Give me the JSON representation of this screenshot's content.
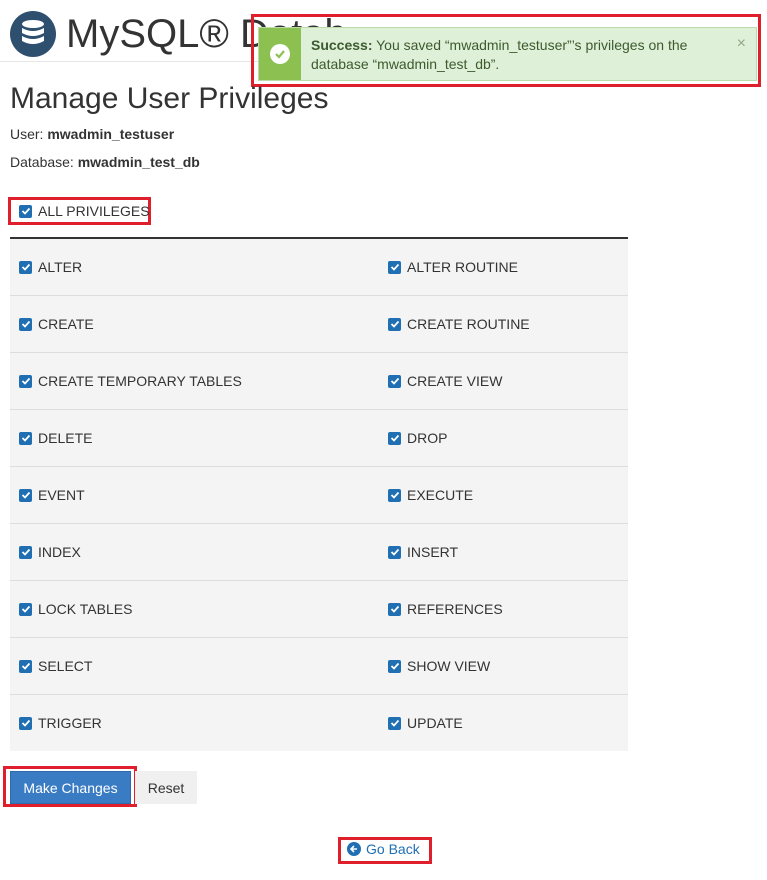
{
  "header": {
    "title": "MySQL® Datab",
    "icon": "database-icon"
  },
  "toast": {
    "title": "Success:",
    "message": "You saved “mwadmin_testuser”’s privileges on the database “mwadmin_test_db”.",
    "close": "×",
    "color": "#dff0d8",
    "accent": "#8cc152"
  },
  "page": {
    "title": "Manage User Privileges",
    "user_label": "User:",
    "user_value": "mwadmin_testuser",
    "db_label": "Database:",
    "db_value": "mwadmin_test_db"
  },
  "all_privileges": {
    "label": "ALL PRIVILEGES",
    "checked": true
  },
  "privileges": [
    [
      "ALTER",
      "ALTER ROUTINE"
    ],
    [
      "CREATE",
      "CREATE ROUTINE"
    ],
    [
      "CREATE TEMPORARY TABLES",
      "CREATE VIEW"
    ],
    [
      "DELETE",
      "DROP"
    ],
    [
      "EVENT",
      "EXECUTE"
    ],
    [
      "INDEX",
      "INSERT"
    ],
    [
      "LOCK TABLES",
      "REFERENCES"
    ],
    [
      "SELECT",
      "SHOW VIEW"
    ],
    [
      "TRIGGER",
      "UPDATE"
    ]
  ],
  "actions": {
    "make_changes": "Make Changes",
    "reset": "Reset",
    "go_back": "Go Back"
  },
  "colors": {
    "primary": "#3a7cc4",
    "checkbox": "#1f6fb2",
    "highlight": "#e01f2d"
  }
}
